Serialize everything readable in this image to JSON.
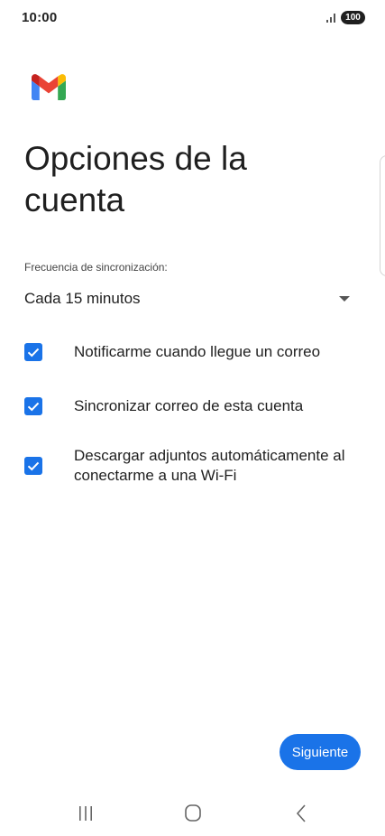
{
  "status_bar": {
    "time": "10:00",
    "battery": "100"
  },
  "header": {
    "title": "Opciones de la cuenta"
  },
  "sync": {
    "label": "Frecuencia de sincronización:",
    "value": "Cada 15 minutos"
  },
  "options": [
    {
      "label": "Notificarme cuando llegue un correo",
      "checked": true
    },
    {
      "label": "Sincronizar correo de esta cuenta",
      "checked": true
    },
    {
      "label": "Descargar adjuntos automáticamente al conectarme a una Wi-Fi",
      "checked": true
    }
  ],
  "footer": {
    "next_label": "Siguiente"
  },
  "icons": {
    "logo": "gmail-logo",
    "dropdown": "dropdown-arrow-icon",
    "checkbox": "checkbox-checked-icon",
    "nav_recents": "recents-icon",
    "nav_home": "home-icon",
    "nav_back": "back-icon"
  },
  "colors": {
    "accent": "#1a73e8",
    "text": "#1f1f1f"
  }
}
